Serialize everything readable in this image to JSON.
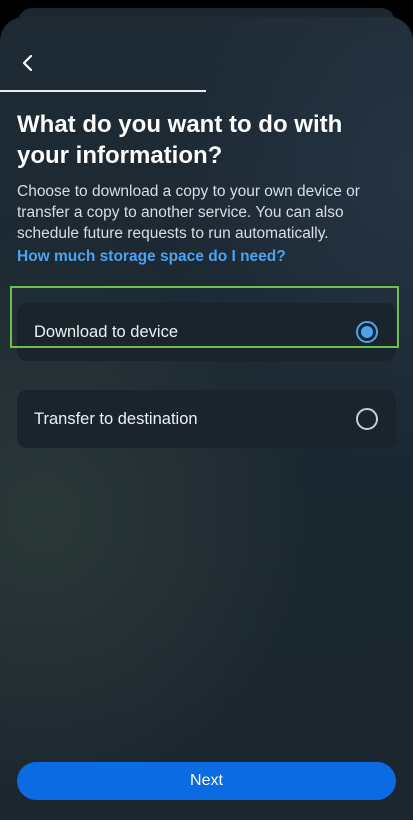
{
  "header": {
    "back_icon": "chevron-left-icon"
  },
  "main": {
    "title": "What do you want to do with your information?",
    "description": "Choose to download a copy to your own device or transfer a copy to another service. You can also schedule future requests to run automatically.",
    "help_link": "How much storage space do I need?",
    "options": [
      {
        "label": "Download to device",
        "selected": true
      },
      {
        "label": "Transfer to destination",
        "selected": false
      }
    ]
  },
  "footer": {
    "next_label": "Next"
  },
  "colors": {
    "accent": "#0a6be3",
    "link": "#4aa3ef",
    "highlight": "#6fbf4f"
  }
}
